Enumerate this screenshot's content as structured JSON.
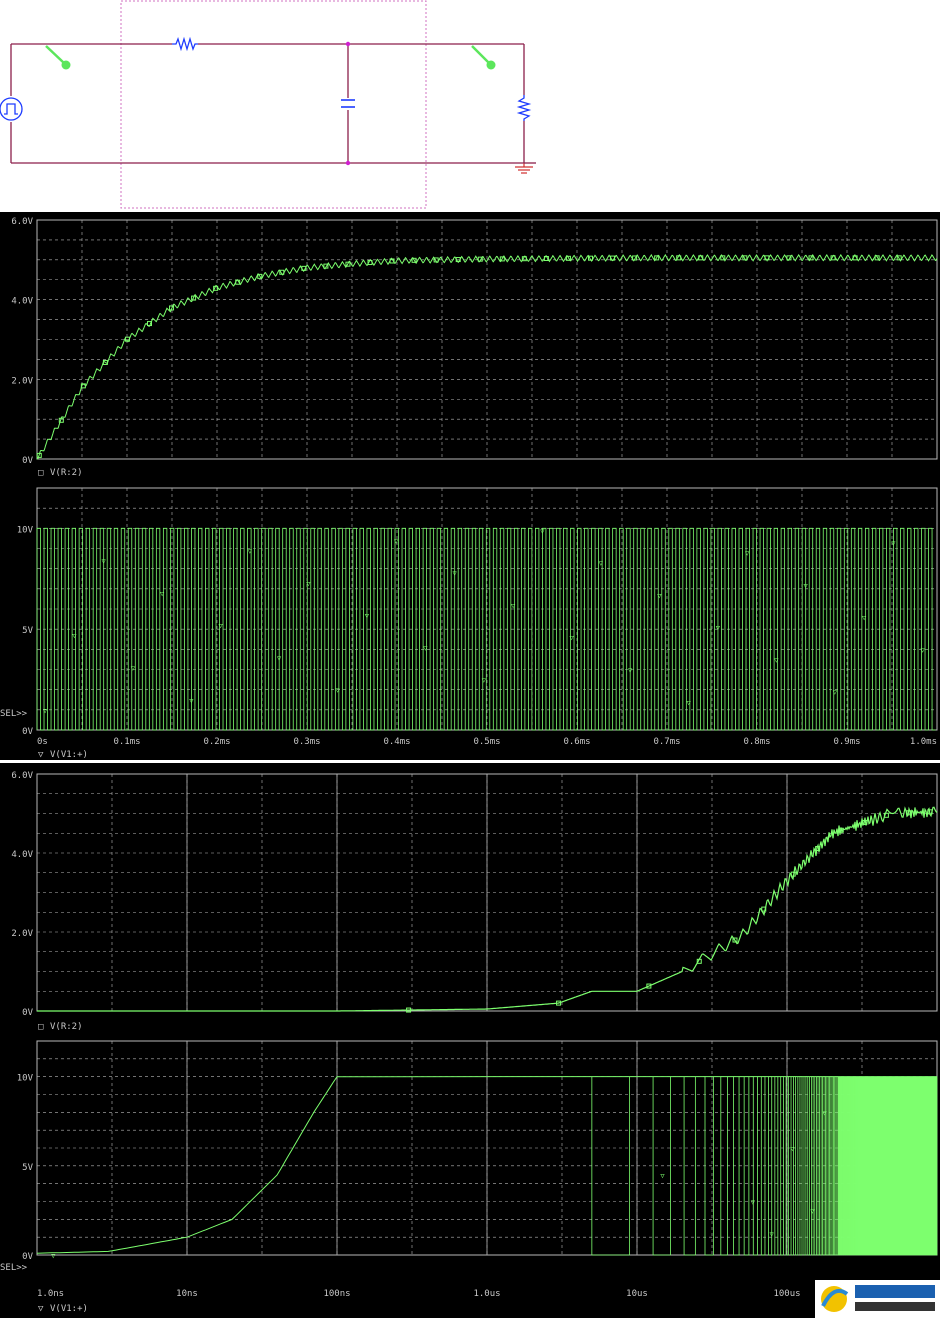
{
  "colors": {
    "trace": "#7dff6e",
    "grid": "#b8b8b8",
    "axis_text": "#c8c8c8",
    "wire": "#8c1f4a",
    "selection": "#d070c0",
    "marker": "#5ce65c",
    "component": "#1e3cff"
  },
  "schematic": {
    "components": [
      "pulse-source-icon",
      "resistor-icon",
      "capacitor-icon",
      "load-resistor-icon",
      "ground-icon",
      "voltage-probe-icon"
    ]
  },
  "chart_data": [
    {
      "type": "line",
      "title": "",
      "xscale": "linear",
      "xlim": [
        0,
        1.0
      ],
      "ylim": [
        0,
        6.0
      ],
      "y_ticks": [
        "6.0V",
        "4.0V",
        "2.0V",
        "0V"
      ],
      "x_ticks": [],
      "legend": [
        {
          "marker": "□",
          "label": "V(R:2)"
        }
      ],
      "series": [
        {
          "name": "V(R:2)",
          "x_ms": [
            0,
            0.05,
            0.1,
            0.15,
            0.2,
            0.25,
            0.3,
            0.35,
            0.4,
            0.5,
            0.6,
            0.7,
            0.8,
            0.9,
            1.0
          ],
          "y_volts": [
            0,
            1.8,
            3.0,
            3.8,
            4.3,
            4.6,
            4.8,
            4.9,
            4.98,
            5.02,
            5.04,
            5.05,
            5.05,
            5.05,
            5.05
          ]
        }
      ],
      "ripple_volts": 0.15,
      "grid": true
    },
    {
      "type": "line",
      "title": "",
      "xscale": "linear",
      "xlim": [
        0,
        1.0
      ],
      "ylim": [
        0,
        12
      ],
      "y_ticks": [
        "10V",
        "5V",
        "0V"
      ],
      "x_ticks": [
        "0s",
        "0.1ms",
        "0.2ms",
        "0.3ms",
        "0.4ms",
        "0.5ms",
        "0.6ms",
        "0.7ms",
        "0.8ms",
        "0.9ms",
        "1.0ms"
      ],
      "sel_label": "SEL>>",
      "legend": [
        {
          "marker": "▽",
          "label": "V(V1:+)"
        }
      ],
      "series": [
        {
          "name": "V(V1:+)",
          "kind": "square-pulse",
          "low_v": 0,
          "high_v": 10,
          "period_ms": 0.0078,
          "cycles": 128
        }
      ],
      "grid": true
    },
    {
      "type": "line",
      "title": "",
      "xscale": "log",
      "xlim_seconds": [
        1e-09,
        0.001
      ],
      "ylim": [
        0,
        6.0
      ],
      "y_ticks": [
        "6.0V",
        "4.0V",
        "2.0V",
        "0V"
      ],
      "x_ticks": [],
      "legend": [
        {
          "marker": "□",
          "label": "V(R:2)"
        }
      ],
      "series": [
        {
          "name": "V(R:2)",
          "x_s": [
            1e-09,
            1e-08,
            1e-07,
            1e-06,
            3e-06,
            5e-06,
            1e-05,
            2e-05,
            5e-05,
            0.0001,
            0.0002,
            0.0005,
            0.001
          ],
          "y_volts": [
            0,
            0,
            0,
            0.05,
            0.2,
            0.5,
            0.5,
            1.0,
            1.9,
            3.3,
            4.5,
            5.0,
            5.05
          ]
        }
      ],
      "grid": true
    },
    {
      "type": "line",
      "title": "",
      "xscale": "log",
      "xlim_seconds": [
        1e-09,
        0.001
      ],
      "ylim": [
        0,
        12
      ],
      "y_ticks": [
        "10V",
        "5V",
        "0V"
      ],
      "x_ticks": [
        "1.0ns",
        "10ns",
        "100ns",
        "1.0us",
        "10us",
        "100us"
      ],
      "sel_label": "SEL>>",
      "legend": [
        {
          "marker": "▽",
          "label": "V(V1:+)"
        }
      ],
      "series": [
        {
          "name": "V(V1:+)",
          "rise_x_s": [
            1e-09,
            3e-09,
            1e-08,
            2e-08,
            4e-08,
            7e-08,
            1e-07
          ],
          "rise_y_volts": [
            0.1,
            0.2,
            1.0,
            2.0,
            4.5,
            8.0,
            10.0
          ],
          "kind": "square-pulse-after-rise",
          "first_fall_s": 5e-06,
          "period_s": 7.8e-06,
          "high_v": 10,
          "low_v": 0
        }
      ],
      "grid": true
    }
  ]
}
